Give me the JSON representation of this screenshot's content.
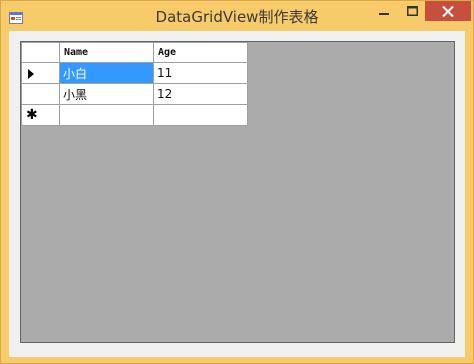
{
  "window": {
    "title": "DataGridView制作表格"
  },
  "grid": {
    "columns": [
      "Name",
      "Age"
    ],
    "rows": [
      {
        "name": "小白",
        "age": "11"
      },
      {
        "name": "小黑",
        "age": "12"
      },
      {
        "name": "",
        "age": ""
      }
    ],
    "selected_cell": "rows.0.name"
  },
  "icons": {
    "current_row": "row-arrow-icon",
    "new_row": "new-row-asterisk-icon",
    "new_row_glyph": "✱"
  },
  "colors": {
    "titlebar": "#f7cb6a",
    "close_button": "#c74f3e",
    "grid_background": "#ababab",
    "selection": "#3399ff"
  }
}
